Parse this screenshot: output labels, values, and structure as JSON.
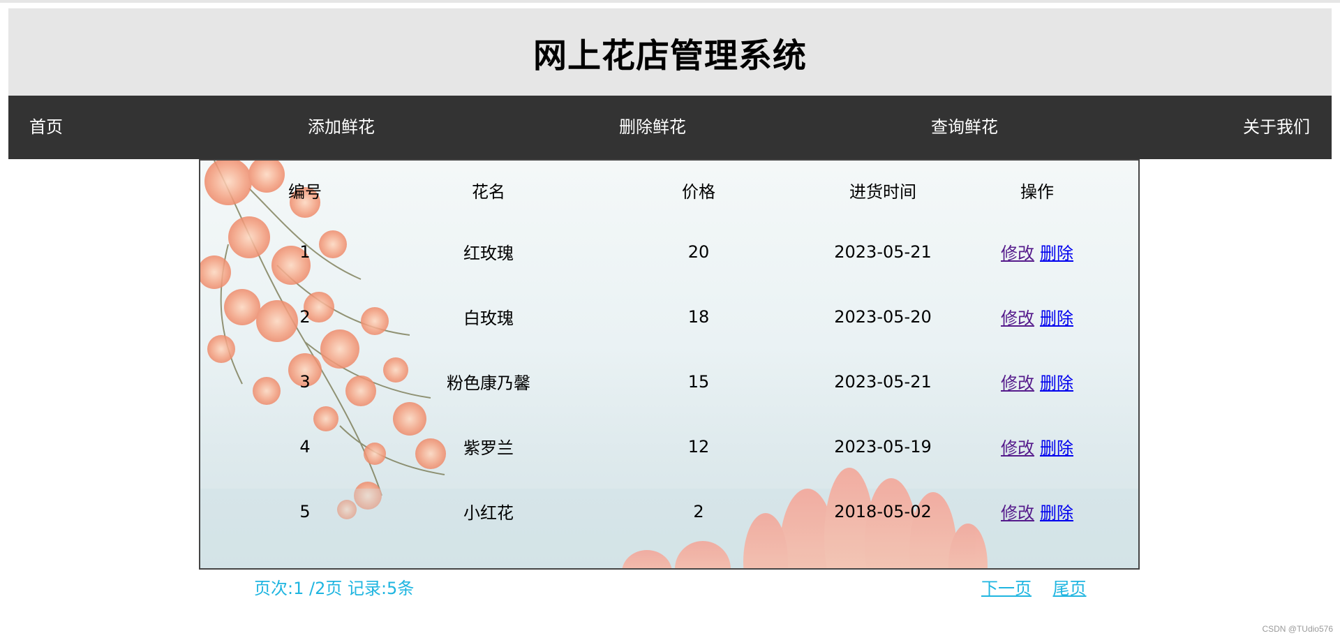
{
  "header": {
    "title": "网上花店管理系统"
  },
  "nav": {
    "items": [
      {
        "label": "首页"
      },
      {
        "label": "添加鲜花"
      },
      {
        "label": "删除鲜花"
      },
      {
        "label": "查询鲜花"
      },
      {
        "label": "关于我们"
      }
    ]
  },
  "table": {
    "columns": [
      "编号",
      "花名",
      "价格",
      "进货时间",
      "操作"
    ],
    "edit_label": "修改",
    "delete_label": "删除",
    "rows": [
      {
        "id": "1",
        "name": "红玫瑰",
        "price": "20",
        "date": "2023-05-21"
      },
      {
        "id": "2",
        "name": "白玫瑰",
        "price": "18",
        "date": "2023-05-20"
      },
      {
        "id": "3",
        "name": "粉色康乃馨",
        "price": "15",
        "date": "2023-05-21"
      },
      {
        "id": "4",
        "name": "紫罗兰",
        "price": "12",
        "date": "2023-05-19"
      },
      {
        "id": "5",
        "name": "小红花",
        "price": "2",
        "date": "2018-05-02"
      }
    ]
  },
  "pager": {
    "status": "页次:1 /2页 记录:5条",
    "next_label": "下一页",
    "last_label": "尾页"
  },
  "watermark": "CSDN @TUdio576",
  "colors": {
    "header_bg": "#e6e6e6",
    "nav_bg": "#333333",
    "pager_link": "#1fb5e0",
    "visited_link": "#551a8b",
    "link": "#0000ee"
  }
}
